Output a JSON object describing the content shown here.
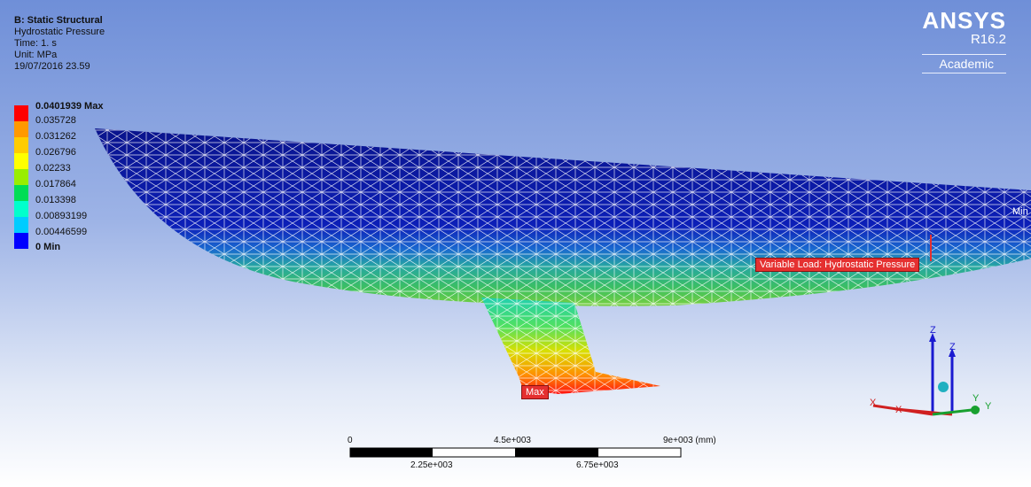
{
  "header": {
    "title": "B: Static Structural",
    "result": "Hydrostatic Pressure",
    "time": "Time: 1. s",
    "unit": "Unit: MPa",
    "timestamp": "19/07/2016 23.59"
  },
  "legend": {
    "max_label": "0.0401939 Max",
    "min_label": "0 Min",
    "levels": [
      "0.035728",
      "0.031262",
      "0.026796",
      "0.02233",
      "0.017864",
      "0.013398",
      "0.00893199",
      "0.00446599"
    ],
    "colors": [
      "#ff0000",
      "#ff9900",
      "#ffcc00",
      "#ffff00",
      "#99ee00",
      "#00dd55",
      "#00ffcc",
      "#00ccff",
      "#0066ff",
      "#0000ff"
    ]
  },
  "branding": {
    "name": "ANSYS",
    "version": "R16.2",
    "edition": "Academic"
  },
  "annotations": {
    "max": "Max",
    "min": "Min",
    "load": "Variable Load: Hydrostatic Pressure"
  },
  "scale_bar": {
    "labels_top": [
      "0",
      "4.5e+003",
      "9e+003 (mm)"
    ],
    "labels_bottom": [
      "2.25e+003",
      "6.75e+003"
    ]
  },
  "triad": {
    "z": "Z",
    "y": "Y",
    "x": "X"
  }
}
